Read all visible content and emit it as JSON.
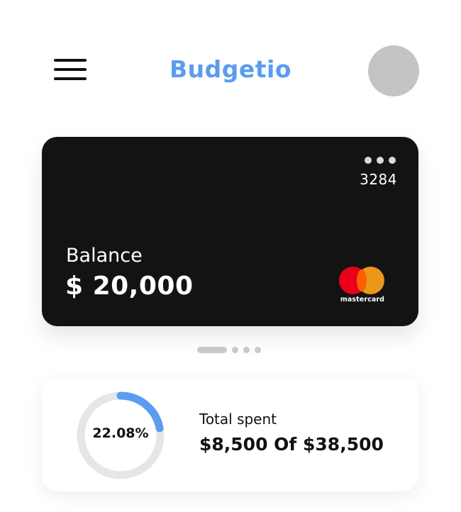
{
  "header": {
    "title": "Budgetio",
    "menu_icon": "hamburger-menu-icon",
    "avatar": "avatar"
  },
  "card": {
    "more_icon": "more-dots-icon",
    "number": "3284",
    "balance_label": "Balance",
    "balance_value": "$ 20,000",
    "brand": "mastercard"
  },
  "pager": {
    "total": 4,
    "active_index": 0
  },
  "spending": {
    "percent_label": "22.08%",
    "progress": 0.2208,
    "label": "Total spent",
    "value": "$8,500 Of $38,500"
  },
  "colors": {
    "accent": "#5b9cf0",
    "card_bg": "#131313",
    "avatar": "#c4c4c4",
    "track": "#e6e6e6",
    "mastercard_red": "#eb001b",
    "mastercard_orange": "#f79e1b"
  }
}
